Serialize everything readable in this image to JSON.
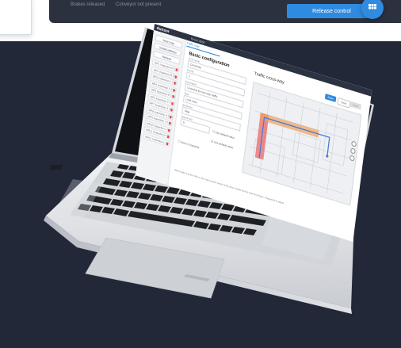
{
  "status_bar": {
    "brakes": "Brakes released",
    "conveyor": "Conveyor not present",
    "release_button": "Release control",
    "apps_icon": "grid-icon"
  },
  "app": {
    "logo": "dunsor",
    "robot_name": "Rovio 3560",
    "sidebar": {
      "buttons": [
        "New map",
        "Global settings",
        "Refresh"
      ],
      "waypoints": [
        "WP1 Inspection A (7.00)",
        "WP2 Inspection B (7.00)",
        "WP3 Inspection C (7.00)",
        "WP4 Inspection D (7.00)",
        "WP5 Inspection E (7.00)",
        "WP6 Inspection F (7.00)",
        "WP7 Inspection G (7.00)",
        "WP8 Inspection H (7.00)",
        "WP9 Inspection I (7.00)",
        "WP10 Inspection J (7.00)",
        "WP11 Inspection K (7.00)",
        "WP12 Inspection L (7.00)"
      ]
    },
    "tab": "Traffic map",
    "form": {
      "title": "Basic configuration",
      "fields": [
        {
          "label": "Zone name",
          "value": "Crossway"
        },
        {
          "label": "Priority",
          "value": "1"
        },
        {
          "label": "Description",
          "value": "Crossing for two-way traffic"
        },
        {
          "label": "Type",
          "value": "Limit zone"
        },
        {
          "label": "Behaviour",
          "value": "Stop"
        },
        {
          "label": "Speed limit",
          "value": "0"
        }
      ],
      "checkboxes": [
        "Use default value",
        "Use default value",
        "Zone is required"
      ]
    },
    "map": {
      "title": "Traffic cross-way",
      "buttons": [
        "Draw",
        "Clear",
        "Save"
      ]
    },
    "footer_note": "When draw is active click on the map to place points of the area. Double click to close the shape. Drag points to adjust."
  },
  "colors": {
    "accent": "#2f8be0",
    "dark_bg": "#232839",
    "zone_red": "#e96060",
    "path_orange": "#f0a15a"
  }
}
